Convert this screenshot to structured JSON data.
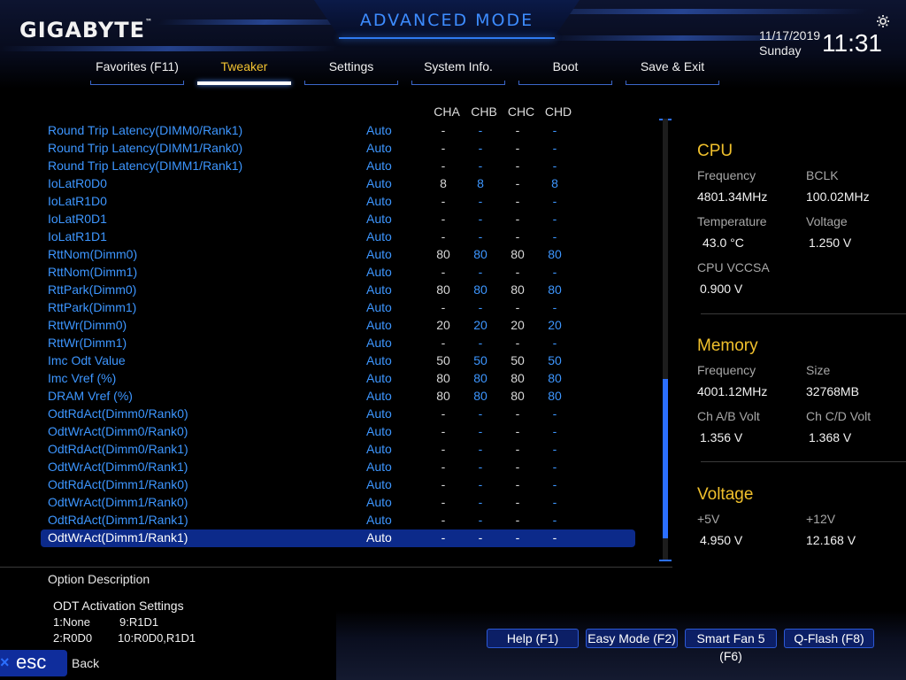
{
  "header": {
    "brand": "GIGABYTE",
    "brand_tm": "™",
    "mode": "ADVANCED MODE",
    "date": "11/17/2019",
    "day": "Sunday",
    "time": "11:31",
    "settings_icon": "gear-icon"
  },
  "tabs": [
    {
      "label": "Favorites (F11)",
      "active": false
    },
    {
      "label": "Tweaker",
      "active": true
    },
    {
      "label": "Settings",
      "active": false
    },
    {
      "label": "System Info.",
      "active": false
    },
    {
      "label": "Boot",
      "active": false
    },
    {
      "label": "Save & Exit",
      "active": false
    }
  ],
  "columns": [
    "CHA",
    "CHB",
    "CHC",
    "CHD"
  ],
  "rows": [
    {
      "name": "Round Trip Latency(DIMM0/Rank1)",
      "value": "Auto",
      "cha": "-",
      "chb": "-",
      "chc": "-",
      "chd": "-"
    },
    {
      "name": "Round Trip Latency(DIMM1/Rank0)",
      "value": "Auto",
      "cha": "-",
      "chb": "-",
      "chc": "-",
      "chd": "-"
    },
    {
      "name": "Round Trip Latency(DIMM1/Rank1)",
      "value": "Auto",
      "cha": "-",
      "chb": "-",
      "chc": "-",
      "chd": "-"
    },
    {
      "name": "IoLatR0D0",
      "value": "Auto",
      "cha": "8",
      "chb": "8",
      "chc": "-",
      "chd": "8"
    },
    {
      "name": "IoLatR1D0",
      "value": "Auto",
      "cha": "-",
      "chb": "-",
      "chc": "-",
      "chd": "-"
    },
    {
      "name": "IoLatR0D1",
      "value": "Auto",
      "cha": "-",
      "chb": "-",
      "chc": "-",
      "chd": "-"
    },
    {
      "name": "IoLatR1D1",
      "value": "Auto",
      "cha": "-",
      "chb": "-",
      "chc": "-",
      "chd": "-"
    },
    {
      "name": "RttNom(Dimm0)",
      "value": "Auto",
      "cha": "80",
      "chb": "80",
      "chc": "80",
      "chd": "80"
    },
    {
      "name": "RttNom(Dimm1)",
      "value": "Auto",
      "cha": "-",
      "chb": "-",
      "chc": "-",
      "chd": "-"
    },
    {
      "name": "RttPark(Dimm0)",
      "value": "Auto",
      "cha": "80",
      "chb": "80",
      "chc": "80",
      "chd": "80"
    },
    {
      "name": "RttPark(Dimm1)",
      "value": "Auto",
      "cha": "-",
      "chb": "-",
      "chc": "-",
      "chd": "-"
    },
    {
      "name": "RttWr(Dimm0)",
      "value": "Auto",
      "cha": "20",
      "chb": "20",
      "chc": "20",
      "chd": "20"
    },
    {
      "name": "RttWr(Dimm1)",
      "value": "Auto",
      "cha": "-",
      "chb": "-",
      "chc": "-",
      "chd": "-"
    },
    {
      "name": "Imc Odt Value",
      "value": "Auto",
      "cha": "50",
      "chb": "50",
      "chc": "50",
      "chd": "50"
    },
    {
      "name": "Imc Vref (%)",
      "value": "Auto",
      "cha": "80",
      "chb": "80",
      "chc": "80",
      "chd": "80"
    },
    {
      "name": "DRAM Vref (%)",
      "value": "Auto",
      "cha": "80",
      "chb": "80",
      "chc": "80",
      "chd": "80"
    },
    {
      "name": "OdtRdAct(Dimm0/Rank0)",
      "value": "Auto",
      "cha": "-",
      "chb": "-",
      "chc": "-",
      "chd": "-"
    },
    {
      "name": "OdtWrAct(Dimm0/Rank0)",
      "value": "Auto",
      "cha": "-",
      "chb": "-",
      "chc": "-",
      "chd": "-"
    },
    {
      "name": "OdtRdAct(Dimm0/Rank1)",
      "value": "Auto",
      "cha": "-",
      "chb": "-",
      "chc": "-",
      "chd": "-"
    },
    {
      "name": "OdtWrAct(Dimm0/Rank1)",
      "value": "Auto",
      "cha": "-",
      "chb": "-",
      "chc": "-",
      "chd": "-"
    },
    {
      "name": "OdtRdAct(Dimm1/Rank0)",
      "value": "Auto",
      "cha": "-",
      "chb": "-",
      "chc": "-",
      "chd": "-"
    },
    {
      "name": "OdtWrAct(Dimm1/Rank0)",
      "value": "Auto",
      "cha": "-",
      "chb": "-",
      "chc": "-",
      "chd": "-"
    },
    {
      "name": "OdtRdAct(Dimm1/Rank1)",
      "value": "Auto",
      "cha": "-",
      "chb": "-",
      "chc": "-",
      "chd": "-"
    },
    {
      "name": "OdtWrAct(Dimm1/Rank1)",
      "value": "Auto",
      "cha": "-",
      "chb": "-",
      "chc": "-",
      "chd": "-",
      "selected": true
    }
  ],
  "panel": {
    "cpu": {
      "title": "CPU",
      "freq_label": "Frequency",
      "freq": "4801.34MHz",
      "bclk_label": "BCLK",
      "bclk": "100.02MHz",
      "temp_label": "Temperature",
      "temp": "43.0 °C",
      "volt_label": "Voltage",
      "volt": "1.250 V",
      "vccsa_label": "CPU VCCSA",
      "vccsa": "0.900 V"
    },
    "memory": {
      "title": "Memory",
      "freq_label": "Frequency",
      "freq": "4001.12MHz",
      "size_label": "Size",
      "size": "32768MB",
      "ab_label": "Ch A/B Volt",
      "ab": "1.356 V",
      "cd_label": "Ch C/D Volt",
      "cd": "1.368 V"
    },
    "voltage": {
      "title": "Voltage",
      "v5_label": "+5V",
      "v5": "4.950 V",
      "v12_label": "+12V",
      "v12": "12.168 V"
    }
  },
  "option": {
    "title": "Option Description",
    "text": "ODT Activation Settings",
    "lines": [
      {
        "a": "1:None",
        "b": "9:R1D1"
      },
      {
        "a": "2:R0D0",
        "b": "10:R0D0,R1D1"
      }
    ]
  },
  "footer": {
    "help": "Help (F1)",
    "easy": "Easy Mode (F2)",
    "fan": "Smart Fan 5 (F6)",
    "qflash": "Q-Flash (F8)",
    "esc": "esc",
    "back": "Back"
  },
  "colors": {
    "accent": "#3d96ff",
    "title_gold": "#f0c02c",
    "selected_row": "#0c2a8a"
  }
}
